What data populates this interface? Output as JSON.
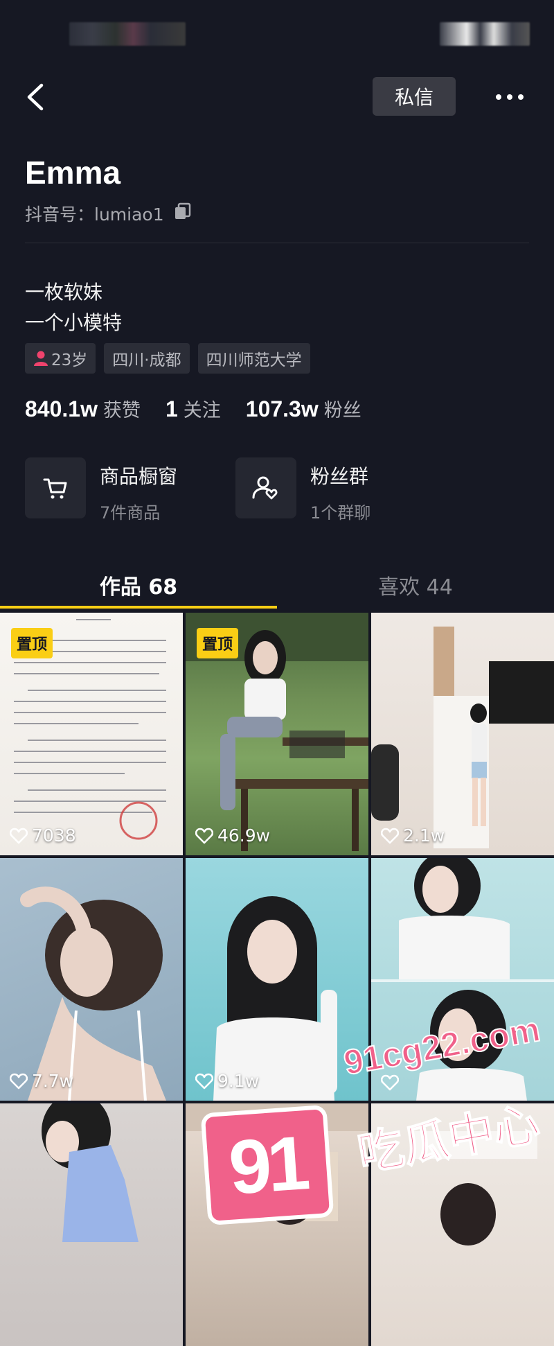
{
  "header": {
    "message_label": "私信"
  },
  "profile": {
    "name": "Emma",
    "douyin_id_label": "抖音号：",
    "douyin_id": "lumiao1",
    "bio_line1": "一枚软妹",
    "bio_line2": "一个小模特",
    "tags": {
      "age": "23岁",
      "location": "四川·成都",
      "school": "四川师范大学"
    },
    "stats": {
      "likes_value": "840.1w",
      "likes_label": "获赞",
      "following_value": "1",
      "following_label": "关注",
      "followers_value": "107.3w",
      "followers_label": "粉丝"
    }
  },
  "shortcuts": {
    "shop": {
      "title": "商品橱窗",
      "subtitle": "7件商品"
    },
    "fan_group": {
      "title": "粉丝群",
      "subtitle": "1个群聊"
    }
  },
  "tabs": {
    "works": "作品 68",
    "liked": "喜欢 44"
  },
  "grid": {
    "pinned_label": "置顶",
    "videos": [
      {
        "likes": "7038",
        "pinned": true
      },
      {
        "likes": "46.9w",
        "pinned": true
      },
      {
        "likes": "2.1w",
        "pinned": false
      },
      {
        "likes": "7.7w",
        "pinned": false
      },
      {
        "likes": "9.1w",
        "pinned": false
      },
      {
        "likes": "",
        "pinned": false
      },
      {
        "likes": "",
        "pinned": false
      },
      {
        "likes": "",
        "pinned": false
      },
      {
        "likes": "",
        "pinned": false
      }
    ]
  },
  "watermark": {
    "badge": "91",
    "url": "91cg22.com",
    "text": "吃瓜中心"
  },
  "colors": {
    "background": "#161823",
    "accent_yellow": "#face15",
    "watermark_pink": "#f0618a"
  }
}
